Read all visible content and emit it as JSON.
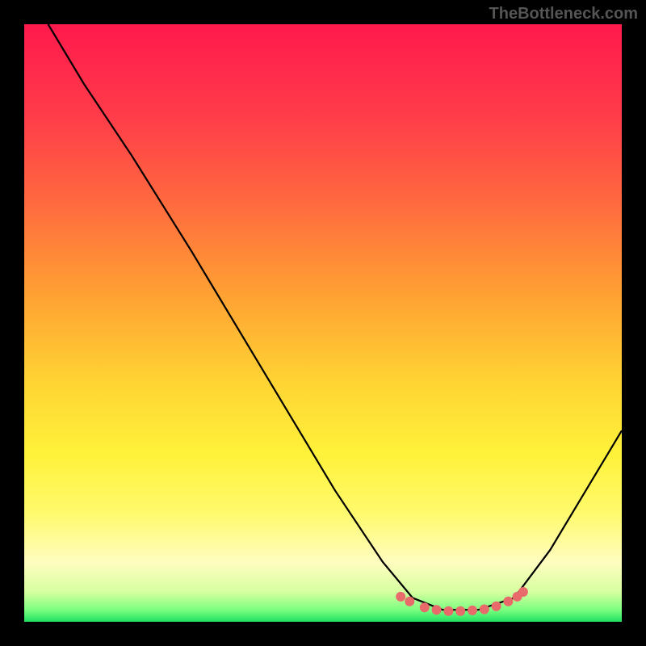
{
  "watermark": "TheBottleneck.com",
  "chart_data": {
    "type": "line",
    "title": "",
    "xlabel": "",
    "ylabel": "",
    "xlim": [
      0,
      100
    ],
    "ylim": [
      0,
      100
    ],
    "background_gradient": {
      "stops": [
        {
          "offset": 0,
          "color": "#ff1a4d"
        },
        {
          "offset": 15,
          "color": "#ff3b4a"
        },
        {
          "offset": 30,
          "color": "#ff6a3f"
        },
        {
          "offset": 45,
          "color": "#ffa033"
        },
        {
          "offset": 60,
          "color": "#ffd433"
        },
        {
          "offset": 72,
          "color": "#fff23a"
        },
        {
          "offset": 82,
          "color": "#fffa6e"
        },
        {
          "offset": 90,
          "color": "#fffdc0"
        },
        {
          "offset": 95,
          "color": "#d6ffa0"
        },
        {
          "offset": 98,
          "color": "#7cff80"
        },
        {
          "offset": 100,
          "color": "#1fe060"
        }
      ]
    },
    "series": [
      {
        "name": "curve",
        "color": "#000000",
        "points": [
          {
            "x": 4,
            "y": 100
          },
          {
            "x": 10,
            "y": 90
          },
          {
            "x": 18,
            "y": 78
          },
          {
            "x": 28,
            "y": 62
          },
          {
            "x": 40,
            "y": 42
          },
          {
            "x": 52,
            "y": 22
          },
          {
            "x": 60,
            "y": 10
          },
          {
            "x": 65,
            "y": 4
          },
          {
            "x": 70,
            "y": 2
          },
          {
            "x": 76,
            "y": 2
          },
          {
            "x": 82,
            "y": 4
          },
          {
            "x": 88,
            "y": 12
          },
          {
            "x": 94,
            "y": 22
          },
          {
            "x": 100,
            "y": 32
          }
        ]
      }
    ],
    "markers": {
      "color": "#e86a6a",
      "radius": 6,
      "points": [
        {
          "x": 63,
          "y": 4.2
        },
        {
          "x": 64.5,
          "y": 3.4
        },
        {
          "x": 67,
          "y": 2.4
        },
        {
          "x": 69,
          "y": 2.0
        },
        {
          "x": 71,
          "y": 1.8
        },
        {
          "x": 73,
          "y": 1.8
        },
        {
          "x": 75,
          "y": 1.9
        },
        {
          "x": 77,
          "y": 2.1
        },
        {
          "x": 79,
          "y": 2.6
        },
        {
          "x": 81,
          "y": 3.4
        },
        {
          "x": 82.5,
          "y": 4.2
        },
        {
          "x": 83.5,
          "y": 5.0
        }
      ]
    }
  }
}
